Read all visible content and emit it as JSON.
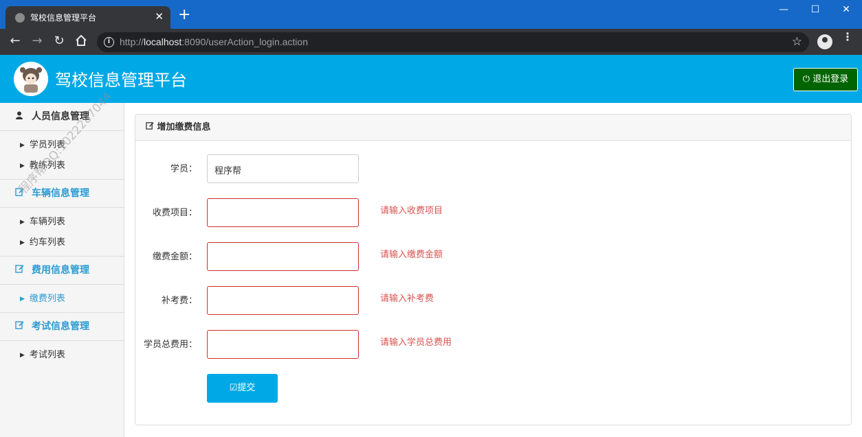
{
  "browser": {
    "tab_title": "驾校信息管理平台",
    "tab_close": "✕",
    "new_tab": "+",
    "url_prefix": "http://",
    "url_host": "localhost",
    "url_rest": ":8090/userAction_login.action",
    "window_minimize": "—",
    "window_maximize": "☐",
    "window_close": "✕"
  },
  "header": {
    "title": "驾校信息管理平台",
    "logout_label": "退出登录"
  },
  "sidebar": {
    "groups": [
      {
        "label": "人员信息管理",
        "icon": "user-icon",
        "items": [
          "学员列表",
          "教练列表"
        ]
      },
      {
        "label": "车辆信息管理",
        "icon": "edit-icon",
        "items": [
          "车辆列表",
          "约车列表"
        ]
      },
      {
        "label": "费用信息管理",
        "icon": "edit-icon",
        "items": [
          "缴费列表"
        ]
      },
      {
        "label": "考试信息管理",
        "icon": "edit-icon",
        "items": [
          "考试列表"
        ]
      }
    ],
    "active_item": "缴费列表"
  },
  "watermark": "程序帮QQ:1022287044",
  "panel": {
    "title": "增加缴费信息",
    "fields": [
      {
        "label": "学员：",
        "value": "程序帮",
        "error": ""
      },
      {
        "label": "收费项目：",
        "value": "",
        "error": "请输入收费项目"
      },
      {
        "label": "缴费金额：",
        "value": "",
        "error": "请输入缴费金额"
      },
      {
        "label": "补考费：",
        "value": "",
        "error": "请输入补考费"
      },
      {
        "label": "学员总费用：",
        "value": "",
        "error": "请输入学员总费用"
      }
    ],
    "submit_label": "提交"
  },
  "colors": {
    "header_bg": "#00a9e6",
    "logout_bg": "#006400",
    "error": "#d9534f",
    "link": "#2b9bd3"
  }
}
